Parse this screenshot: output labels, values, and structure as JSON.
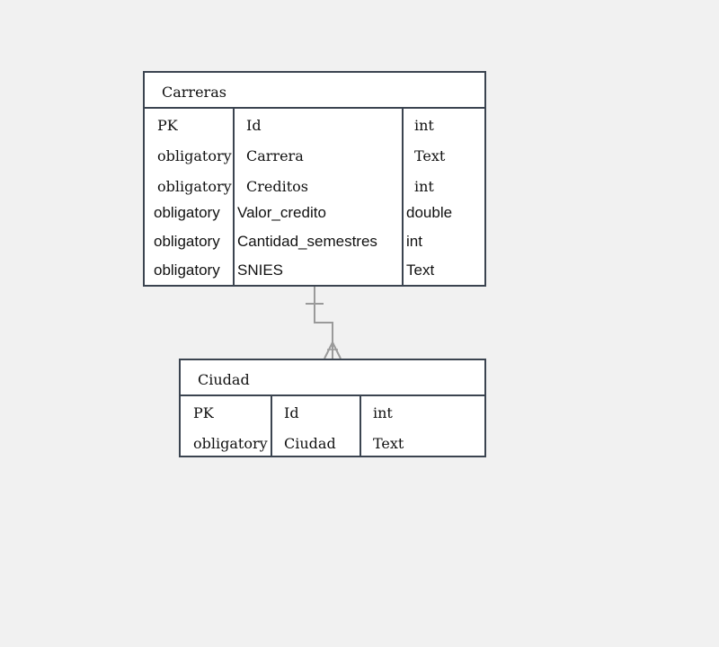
{
  "entities": {
    "carreras": {
      "title": "Carreras",
      "rows": [
        {
          "key": "PK",
          "name": "Id",
          "type": "int"
        },
        {
          "key": "obligatory",
          "name": "Carrera",
          "type": "Text"
        },
        {
          "key": "obligatory",
          "name": "Creditos",
          "type": "int"
        },
        {
          "key": "obligatory",
          "name": "Valor_credito",
          "type": "double"
        },
        {
          "key": "obligatory",
          "name": "Cantidad_semestres",
          "type": "int"
        },
        {
          "key": "obligatory",
          "name": "SNIES",
          "type": "Text"
        }
      ]
    },
    "ciudad": {
      "title": "Ciudad",
      "rows": [
        {
          "key": "PK",
          "name": "Id",
          "type": "int"
        },
        {
          "key": "obligatory",
          "name": "Ciudad",
          "type": "Text"
        }
      ]
    }
  },
  "relationship": {
    "from": "Carreras",
    "to": "Ciudad",
    "from_cardinality": "one-and-only-one",
    "to_cardinality": "one-or-many",
    "line_color": "#9a9a9a"
  },
  "colors": {
    "background": "#f1f1f1",
    "entity_border": "#3b4450",
    "entity_fill": "#ffffff"
  }
}
